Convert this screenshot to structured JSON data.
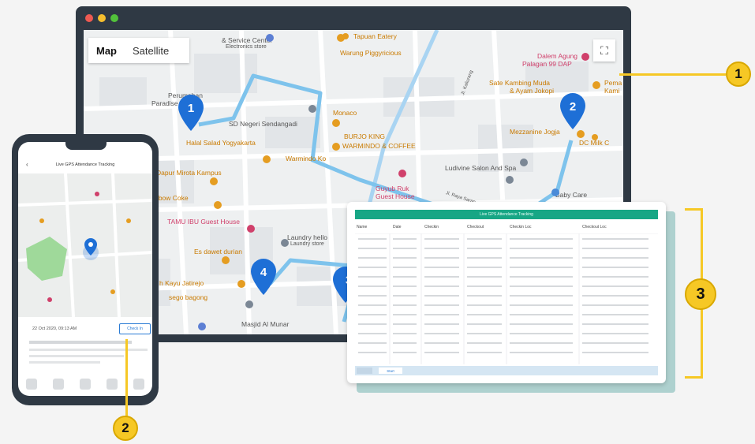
{
  "map": {
    "tabs": [
      "Map",
      "Satellite"
    ],
    "fullscreen_icon": "fullscreen-icon",
    "pins": [
      "1",
      "2",
      "3",
      "4"
    ],
    "route_color": "#7ec3ec",
    "pin_color": "#1e6fd6",
    "places": {
      "service_center": "& Service Center",
      "electronics_store": "Electronics store",
      "warung": "Warung Piggyricious",
      "tapuan_eatery": "Tapuan Eatery",
      "dalem_agung_1": "Dalem Agung",
      "dalem_agung_2": "Palagan 99 DAP",
      "perumahan_1": "Perumahan",
      "perumahan_2": "Paradise R",
      "sate_1": "Sate Kambing Muda",
      "sate_2": "& Ayam Jokopi",
      "pemo": "Pema",
      "pemo_2": "Kami",
      "sd_negeri": "SD Negeri Sendangadi",
      "monaco": "Monaco",
      "burger_1": "BURJO KING",
      "burger_2": "WARMINDO & COFFEE",
      "mezzanine": "Mezzanine Jogja",
      "dc_milk": "DC Milk C",
      "halal_salad": "Halal Salad Yogyakarta",
      "warmindo": "Warmindo Ko",
      "ludivine": "Ludivine Salon And Spa",
      "dapur": "Dapur Mirota Kampus",
      "arbow": "rbow Coke",
      "guyub_1": "Guyub Ruk",
      "guyub_2": "Guest House",
      "baby_care": "Baby Care",
      "tamu_ibu": "TAMU IBU Guest House",
      "laundry_1": "Laundry hello",
      "laundry_2": "Laundry store",
      "es_dawet": "Es dawet durian",
      "kayu": "h Kayu Jatirejo",
      "sego": "sego bagong",
      "masjid": "Masjid Al Munar",
      "street_1": "Jl. Kaliurang",
      "street_2": "Jl. Raya Saran"
    }
  },
  "phone": {
    "title": "Live GPS Attendance Tracking",
    "date": "22 Oct 2020, 09:13 AM",
    "checkin_button": "Check In",
    "pin": "A"
  },
  "table": {
    "title": "Live GPS Attendance Tracking",
    "columns": [
      "Name",
      "Date",
      "Checkin",
      "Checkout",
      "Checkin Loc",
      "Checkout Loc"
    ],
    "footer_button": "Start"
  },
  "callouts": [
    "1",
    "2",
    "3"
  ],
  "colors": {
    "accent": "#f6c825",
    "table_header": "#17a685",
    "device": "#2f3944"
  }
}
